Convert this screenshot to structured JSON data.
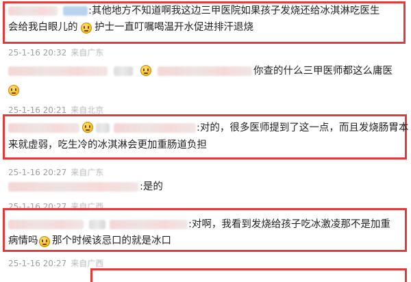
{
  "comments": [
    {
      "line1": ":其他地方不知道啊我这边三甲医院如果孩子发烧还给冰淇淋吃医生",
      "line2_pre": "会给我白眼儿的",
      "line2_post": "护士一直叮嘱喝温开水促进排汗退烧",
      "time": "25-1-16 20:32",
      "source": "来自广东"
    },
    {
      "line1": "你查的什么三甲医师都这么庸医",
      "time": "25-1-16 20:21",
      "source": "来自北京"
    },
    {
      "line1": ":对的，很多医师提到了这一点，而且发烧肠胃本",
      "line2": "来就虚弱，吃生冷的冰淇淋会更加重肠道负担",
      "time": "25-1-16 20:27",
      "source": "来自广东"
    },
    {
      "line1": ":是的",
      "time": "25-1-16 20:27",
      "source": "来自广西"
    },
    {
      "line1": ":对啊，我看到发烧给孩子吃冰激凌那不是加重",
      "line2_pre": "病情吗",
      "line2_post": "那个时候该忌口的就是冰口",
      "time": "25-1-16 20:27",
      "source": "来自广西"
    }
  ],
  "icons": {
    "emoji": "grimace-emoji-icon"
  },
  "colors": {
    "highlight_border": "#e23a3a",
    "meta_text": "#a0a0a0"
  }
}
